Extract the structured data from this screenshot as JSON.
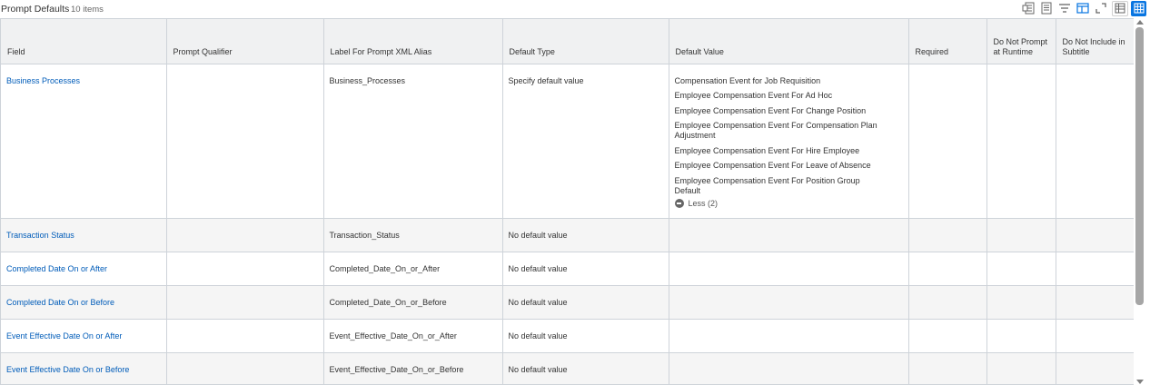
{
  "header": {
    "title": "Prompt Defaults",
    "count": "10 items"
  },
  "toolbar": {
    "icons": [
      "export-excel-icon",
      "export-pdf-icon",
      "filter-icon",
      "column-chooser-icon",
      "fullscreen-icon",
      "table-view-icon",
      "grid-view-icon"
    ]
  },
  "table": {
    "columns": {
      "field": "Field",
      "prompt_qualifier": "Prompt Qualifier",
      "label_alias": "Label For Prompt XML Alias",
      "default_type": "Default Type",
      "default_value": "Default Value",
      "required": "Required",
      "do_not_prompt": "Do Not Prompt at Runtime",
      "do_not_include": "Do Not Include in Subtitle"
    },
    "rows": [
      {
        "field": "Business Processes",
        "prompt_qualifier": "",
        "label_alias": "Business_Processes",
        "default_type": "Specify default value",
        "default_values": [
          "Compensation Event for Job Requisition",
          "Employee Compensation Event For Ad Hoc",
          "Employee Compensation Event For Change Position",
          "Employee Compensation Event For Compensation Plan Adjustment",
          "Employee Compensation Event For Hire Employee",
          "Employee Compensation Event For Leave of Absence",
          "Employee Compensation Event For Position Group Default"
        ],
        "less_label": "Less (2)"
      },
      {
        "field": "Transaction Status",
        "prompt_qualifier": "",
        "label_alias": "Transaction_Status",
        "default_type": "No default value"
      },
      {
        "field": "Completed Date On or After",
        "prompt_qualifier": "",
        "label_alias": "Completed_Date_On_or_After",
        "default_type": "No default value"
      },
      {
        "field": "Completed Date On or Before",
        "prompt_qualifier": "",
        "label_alias": "Completed_Date_On_or_Before",
        "default_type": "No default value"
      },
      {
        "field": "Event Effective Date On or After",
        "prompt_qualifier": "",
        "label_alias": "Event_Effective_Date_On_or_After",
        "default_type": "No default value"
      },
      {
        "field": "Event Effective Date On or Before",
        "prompt_qualifier": "",
        "label_alias": "Event_Effective_Date_On_or_Before",
        "default_type": "No default value"
      }
    ]
  },
  "colors": {
    "link": "#005cb9",
    "header_bg": "#f0f1f2",
    "alt_row_bg": "#f5f5f5",
    "border": "#ced3d9",
    "active_tool": "#0875e1"
  }
}
